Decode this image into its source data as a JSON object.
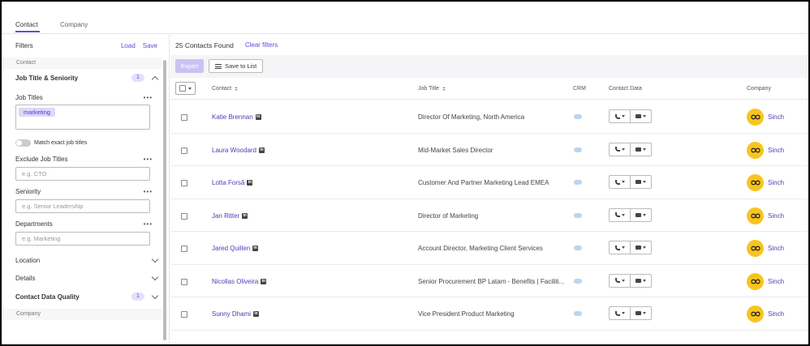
{
  "tabs": [
    {
      "label": "Contact",
      "active": true
    },
    {
      "label": "Company",
      "active": false
    }
  ],
  "sidebar": {
    "filters_label": "Filters",
    "load_label": "Load",
    "save_label": "Save",
    "section_contact": "Contact",
    "job_title_seniority": {
      "label": "Job Title & Seniority",
      "badge": "1"
    },
    "job_titles": {
      "label": "Job Titles",
      "tags": [
        "marketing"
      ]
    },
    "match_exact_label": "Match exact job titles",
    "exclude_job_titles": {
      "label": "Exclude Job Titles",
      "placeholder": "e.g. CTO"
    },
    "seniority": {
      "label": "Seniority",
      "placeholder": "e.g. Senior Leadership"
    },
    "departments": {
      "label": "Departments",
      "placeholder": "e.g. Marketing"
    },
    "location_label": "Location",
    "details_label": "Details",
    "contact_data_quality": {
      "label": "Contact Data Quality",
      "badge": "1"
    },
    "section_company": "Company"
  },
  "main": {
    "results_count": "25 Contacts Found",
    "clear_filters": "Clear filters",
    "export_label": "Export",
    "save_to_list_label": "Save to List",
    "columns": {
      "contact": "Contact",
      "job_title": "Job Title",
      "crm": "CRM",
      "contact_data": "Contact Data",
      "company": "Company"
    },
    "rows": [
      {
        "name": "Katie Brennan",
        "job_title": "Director Of Marketing, North America",
        "company": "Sinch"
      },
      {
        "name": "Laura Woodard",
        "job_title": "Mid-Market Sales Director",
        "company": "Sinch"
      },
      {
        "name": "Lotta Forsã",
        "job_title": "Customer And Partner Marketing Lead EMEA",
        "company": "Sinch"
      },
      {
        "name": "Jan Ritter",
        "job_title": "Director of Marketing",
        "company": "Sinch"
      },
      {
        "name": "Jared Quillen",
        "job_title": "Account Director, Marketing Client Services",
        "company": "Sinch"
      },
      {
        "name": "Nicollas Oliveira",
        "job_title": "Senior Procurement BP Latam - Benefits | Faciliti...",
        "company": "Sinch"
      },
      {
        "name": "Sunny Dhami",
        "job_title": "Vice President Product Marketing",
        "company": "Sinch"
      }
    ]
  },
  "colors": {
    "accent": "#5b4fd6",
    "sinch_yellow": "#f8c51e"
  }
}
